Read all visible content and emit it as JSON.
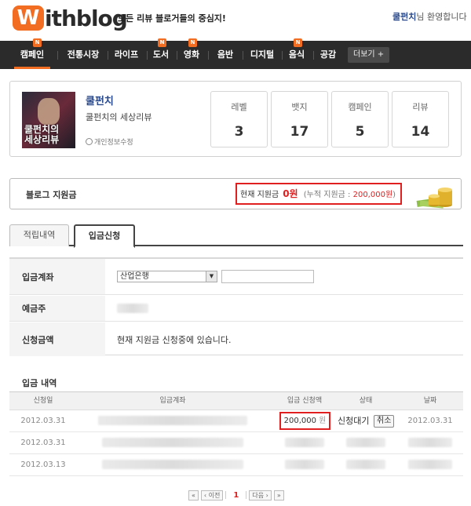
{
  "header": {
    "logo_mark": "W",
    "logo_text": "ithblog",
    "tagline": "모든 리뷰 블로거들의 중심지!",
    "username": "쿨펀치",
    "welcome_suffix": "님 환영합니다"
  },
  "nav": {
    "items": [
      {
        "label": "캠페인",
        "new": true,
        "active": true
      },
      {
        "label": "전통시장",
        "new": false
      },
      {
        "label": "라이프",
        "new": false
      },
      {
        "label": "도서",
        "new": true
      },
      {
        "label": "영화",
        "new": true
      },
      {
        "label": "음반",
        "new": false
      },
      {
        "label": "디지털",
        "new": false
      },
      {
        "label": "음식",
        "new": true
      },
      {
        "label": "공감",
        "new": false
      }
    ],
    "new_badge": "N",
    "more_label": "더보기 +"
  },
  "profile": {
    "avatar_text_1": "쿨펀치의",
    "avatar_text_2": "세상리뷰",
    "blog_name": "쿨펀치",
    "blog_desc": "쿨펀치의 세상리뷰",
    "edit_info": "개인정보수정",
    "stats": [
      {
        "label": "레벨",
        "value": "3"
      },
      {
        "label": "뱃지",
        "value": "17"
      },
      {
        "label": "캠페인",
        "value": "5"
      },
      {
        "label": "리뷰",
        "value": "14"
      }
    ]
  },
  "fund": {
    "label": "블로그 지원금",
    "current_label": "현재 지원금",
    "current_amount": "0원",
    "cumulative_prefix": "(누적 지원금 :",
    "cumulative_value": "200,000원",
    "cumulative_suffix": ")"
  },
  "tabs": {
    "earn": "적립내역",
    "deposit": "입금신청"
  },
  "form": {
    "account_label": "입금계좌",
    "bank_selected": "산업은행",
    "holder_label": "예금주",
    "request_label": "신청금액",
    "request_message": "현재 지원금 신청중에 있습니다."
  },
  "history": {
    "title": "입금 내역",
    "columns": [
      "신청일",
      "입금계좌",
      "입금 신청액",
      "상태",
      "날짜"
    ],
    "rows": [
      {
        "date": "2012.03.31",
        "amount": "200,000",
        "unit": "원",
        "status": "신청대기",
        "action": "취소",
        "done_date": "2012.03.31"
      },
      {
        "date": "2012.03.31"
      },
      {
        "date": "2012.03.13"
      }
    ]
  },
  "pager": {
    "first": "«",
    "prev": "‹ 이전",
    "page": "1",
    "next": "다음 ›",
    "last": "»"
  },
  "colors": {
    "brand_orange": "#f26d21",
    "nav_bg": "#2b2b2b",
    "highlight_red": "#e02020",
    "link_blue": "#2b4a8c"
  }
}
